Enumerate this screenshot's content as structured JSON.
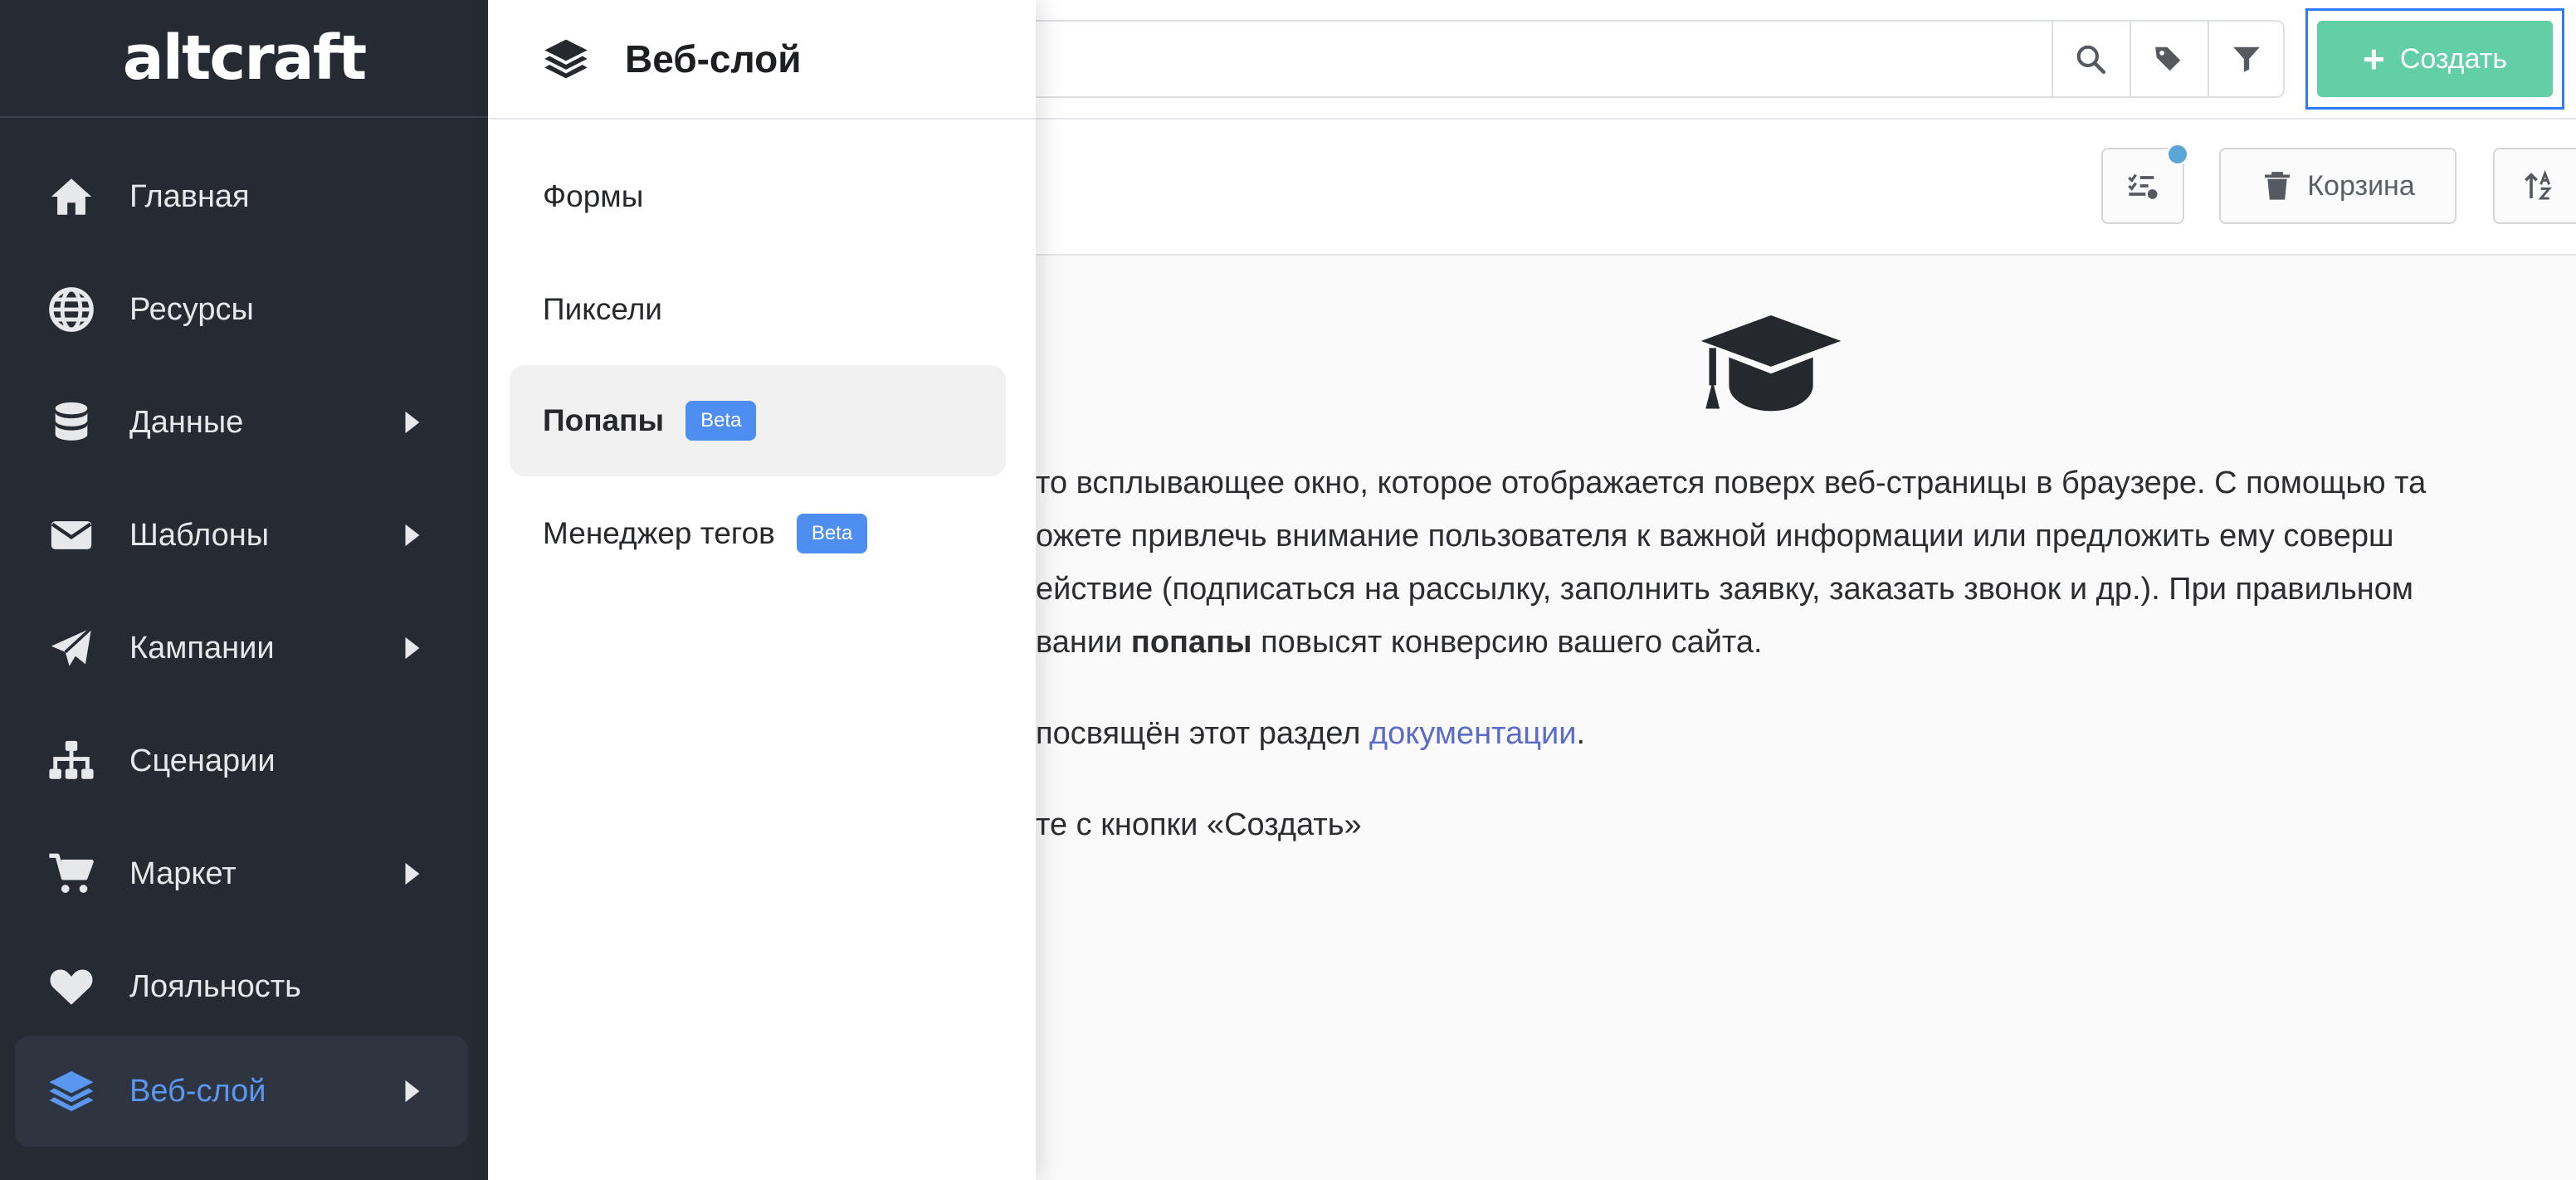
{
  "logo": "altcraft",
  "sidebar": {
    "items": [
      {
        "label": "Главная",
        "icon": "home-icon",
        "has_arrow": false
      },
      {
        "label": "Ресурсы",
        "icon": "globe-icon",
        "has_arrow": false
      },
      {
        "label": "Данные",
        "icon": "database-icon",
        "has_arrow": true
      },
      {
        "label": "Шаблоны",
        "icon": "envelope-icon",
        "has_arrow": true
      },
      {
        "label": "Кампании",
        "icon": "paper-plane-icon",
        "has_arrow": true
      },
      {
        "label": "Сценарии",
        "icon": "sitemap-icon",
        "has_arrow": false
      },
      {
        "label": "Маркет",
        "icon": "cart-icon",
        "has_arrow": true
      },
      {
        "label": "Лояльность",
        "icon": "heart-icon",
        "has_arrow": false
      },
      {
        "label": "Веб-слой",
        "icon": "layers-icon",
        "has_arrow": true,
        "active": true
      }
    ]
  },
  "submenu": {
    "title": "Веб-слой",
    "items": [
      {
        "label": "Формы"
      },
      {
        "label": "Пиксели"
      },
      {
        "label": "Попапы",
        "badge": "Beta",
        "active": true
      },
      {
        "label": "Менеджер тегов",
        "badge": "Beta"
      }
    ]
  },
  "topbar": {
    "search_placeholder": "",
    "create_label": "Создать",
    "create_icon": "plus-icon"
  },
  "toolbar": {
    "tasks_icon": "task-list-icon",
    "trash_label": "Корзина",
    "sort_icon": "sort-alpha-icon"
  },
  "content": {
    "icon": "graduation-cap-icon",
    "line1": "то всплывающее окно, которое отображается поверх веб-страницы в браузере. С помощью та",
    "line2": "ожете привлечь внимание пользователя к важной информации или предложить ему соверш",
    "line3": "ействие (подписаться на рассылку, заполнить заявку, заказать звонок и др.). При правильном",
    "line4_pre": "вании ",
    "line4_bold": "попапы",
    "line4_post": " повысят конверсию вашего сайта.",
    "line5_pre": "посвящён этот раздел ",
    "line5_link": "документации",
    "line5_post": ".",
    "line6": "те с кнопки «Создать»"
  },
  "colors": {
    "sidebar_bg": "#252a33",
    "accent_blue": "#5b97f0",
    "create_green": "#62cfa6",
    "beta_blue": "#4e8ef0",
    "link": "#5a6cc8"
  }
}
